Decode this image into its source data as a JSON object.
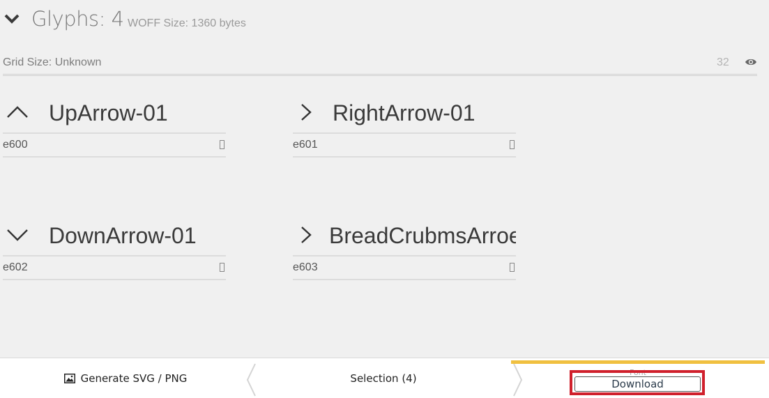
{
  "header": {
    "title": "Glyphs: 4",
    "woff_size": "WOFF Size: 1360 bytes"
  },
  "grid": {
    "label": "Grid Size: Unknown",
    "value": "32"
  },
  "glyphs": [
    {
      "name": "UpArrow-01",
      "code": "e600",
      "icon": "chevron-up-icon"
    },
    {
      "name": "RightArrow-01",
      "code": "e601",
      "icon": "chevron-right-icon"
    },
    {
      "name": "DownArrow-01",
      "code": "e602",
      "icon": "chevron-down-icon"
    },
    {
      "name": "BreadCrubmsArroe",
      "code": "e603",
      "icon": "chevron-right-icon"
    }
  ],
  "bottom_bar": {
    "generate_label": "Generate SVG / PNG",
    "selection_label": "Selection (4)",
    "font_label": "Font",
    "download_label": "Download"
  },
  "colors": {
    "accent": "#f0c040",
    "highlight": "#d0202c"
  }
}
